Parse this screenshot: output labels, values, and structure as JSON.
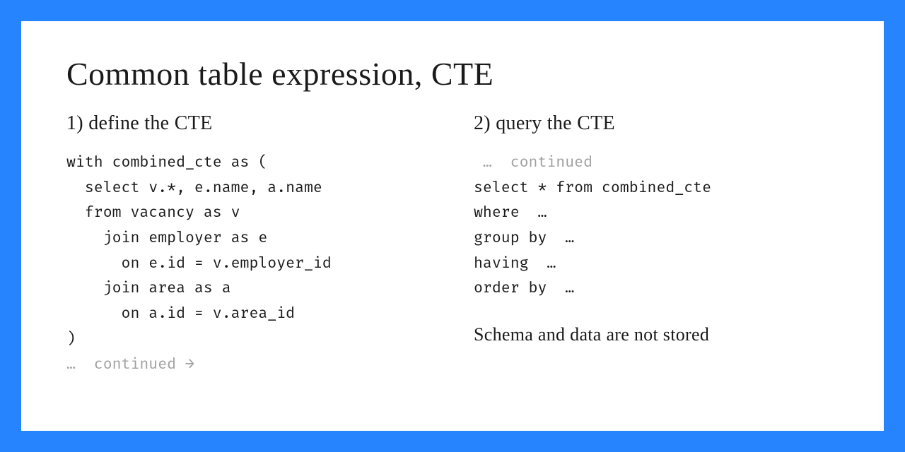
{
  "title": "Common table expression, CTE",
  "left": {
    "subtitle": "1) define the CTE",
    "code_main": "with combined_cte as (\n  select v.*, e.name, a.name\n  from vacancy as v\n    join employer as e\n      on e.id = v.employer_id\n    join area as a\n      on a.id = v.area_id\n)",
    "code_muted": "…  continued →"
  },
  "right": {
    "subtitle": "2) query the CTE",
    "code_muted": " …  continued",
    "code_main": "select * from combined_cte\nwhere  …\ngroup by  …\nhaving  …\norder by  …",
    "note": "Schema and data are not stored"
  }
}
